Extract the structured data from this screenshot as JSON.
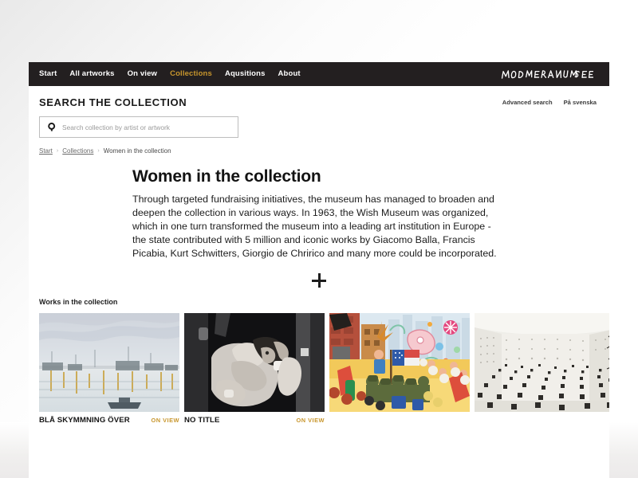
{
  "nav": {
    "items": [
      {
        "label": "Start",
        "active": false
      },
      {
        "label": "All artworks",
        "active": false
      },
      {
        "label": "On view",
        "active": false
      },
      {
        "label": "Collections",
        "active": true
      },
      {
        "label": "Aqusitions",
        "active": false
      },
      {
        "label": "About",
        "active": false
      }
    ],
    "brand": "MODERNA MUSEET"
  },
  "search": {
    "title": "SEARCH THE COLLECTION",
    "placeholder": "Search collection by artist or artwork",
    "value": "",
    "advanced_label": "Advanced search",
    "language_label": "På svenska"
  },
  "breadcrumb": {
    "items": [
      {
        "label": "Start",
        "link": true
      },
      {
        "label": "Collections",
        "link": true
      },
      {
        "label": "Women in the collection",
        "link": false
      }
    ],
    "separator": "›"
  },
  "article": {
    "title": "Women in the collection",
    "body": "Through targeted fundraising initiatives, the museum has managed to broaden and deepen the collection in various ways. In 1963, the Wish Museum was organized, which in one turn transformed the museum into a leading art institution in Europe - the state contributed with 5 million and iconic works by Giacomo Balla, Francis Picabia, Kurt Schwitters, Giorgio de Chririco and many more could be incorporated.",
    "expand_icon": "plus-icon"
  },
  "works": {
    "label": "Works in the collection",
    "items": [
      {
        "title": "BLÅ SKYMMNING ÖVER",
        "badge": "ON VIEW",
        "has_badge": true,
        "thumb": "watercolor-harbour-scene"
      },
      {
        "title": "NO TITLE",
        "badge": "ON VIEW",
        "has_badge": true,
        "thumb": "black-white-photograph"
      },
      {
        "title": "",
        "badge": "",
        "has_badge": false,
        "thumb": "colorful-parade-painting"
      },
      {
        "title": "",
        "badge": "",
        "has_badge": false,
        "thumb": "white-room-installation"
      }
    ]
  },
  "colors": {
    "accent": "#c8962d",
    "topbar": "#231f20",
    "page": "#ffffff"
  }
}
